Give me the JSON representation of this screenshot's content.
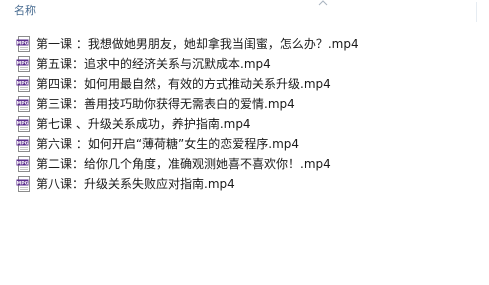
{
  "header": {
    "column_label": "名称"
  },
  "icon_label": "MPG",
  "files": [
    {
      "name": "第一课 ：我想做她男朋友，她却拿我当闺蜜，怎么办？.mp4"
    },
    {
      "name": "第五课：追求中的经济关系与沉默成本.mp4"
    },
    {
      "name": "第四课：如何用最自然，有效的方式推动关系升级.mp4"
    },
    {
      "name": "第三课：善用技巧助你获得无需表白的爱情.mp4"
    },
    {
      "name": "第七课 、升级关系成功，养护指南.mp4"
    },
    {
      "name": "第六课 ：如何开启“薄荷糖”女生的恋爱程序.mp4"
    },
    {
      "name": "第二课：给你几个角度，准确观测她喜不喜欢你！.mp4"
    },
    {
      "name": "第八课：升级关系失败应对指南.mp4"
    }
  ]
}
